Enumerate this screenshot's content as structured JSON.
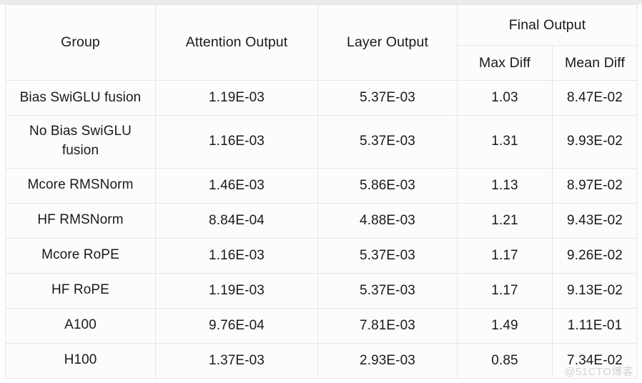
{
  "table": {
    "headers": {
      "group": "Group",
      "attention_output": "Attention Output",
      "layer_output": "Layer Output",
      "final_output": "Final Output",
      "max_diff": "Max Diff",
      "mean_diff": "Mean Diff"
    },
    "rows": [
      {
        "group": "Bias SwiGLU fusion",
        "attention_output": "1.19E-03",
        "layer_output": "5.37E-03",
        "max_diff": "1.03",
        "mean_diff": "8.47E-02"
      },
      {
        "group": "No Bias SwiGLU fusion",
        "attention_output": "1.16E-03",
        "layer_output": "5.37E-03",
        "max_diff": "1.31",
        "mean_diff": "9.93E-02"
      },
      {
        "group": "Mcore RMSNorm",
        "attention_output": "1.46E-03",
        "layer_output": "5.86E-03",
        "max_diff": "1.13",
        "mean_diff": "8.97E-02"
      },
      {
        "group": "HF RMSNorm",
        "attention_output": "8.84E-04",
        "layer_output": "4.88E-03",
        "max_diff": "1.21",
        "mean_diff": "9.43E-02"
      },
      {
        "group": "Mcore RoPE",
        "attention_output": "1.16E-03",
        "layer_output": "5.37E-03",
        "max_diff": "1.17",
        "mean_diff": "9.26E-02"
      },
      {
        "group": "HF RoPE",
        "attention_output": "1.19E-03",
        "layer_output": "5.37E-03",
        "max_diff": "1.17",
        "mean_diff": "9.13E-02"
      },
      {
        "group": "A100",
        "attention_output": "9.76E-04",
        "layer_output": "7.81E-03",
        "max_diff": "1.49",
        "mean_diff": "1.11E-01"
      },
      {
        "group": "H100",
        "attention_output": "1.37E-03",
        "layer_output": "2.93E-03",
        "max_diff": "0.85",
        "mean_diff": "7.34E-02"
      }
    ]
  },
  "watermark": {
    "text": "@51CTO博客"
  }
}
